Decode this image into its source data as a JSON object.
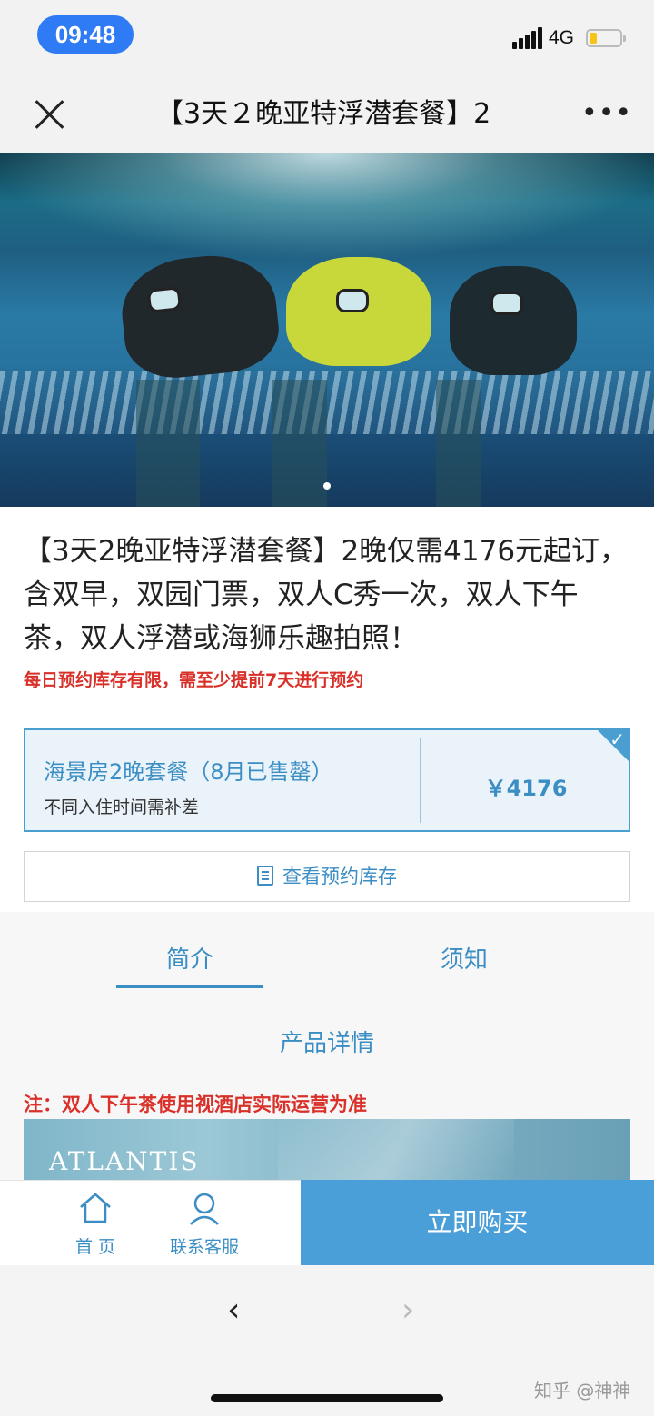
{
  "status_bar": {
    "time": "09:48",
    "network": "4G",
    "battery_level": 0.25
  },
  "nav": {
    "title": "【3天２晚亚特浮潜套餐】2",
    "close_icon": "close-icon",
    "more_label": "•••"
  },
  "product": {
    "title": "【3天2晚亚特浮潜套餐】2晚仅需4176元起订，含双早，双园门票，双人C秀一次，双人下午茶，双人浮潜或海狮乐趣拍照！",
    "notice": "每日预约库存有限，需至少提前7天进行预约"
  },
  "package": {
    "name": "海景房2晚套餐（8月已售罄）",
    "subtitle": "不同入住时间需补差",
    "price": "￥4176",
    "selected": true
  },
  "stock_button": {
    "label": "查看预约库存"
  },
  "tabs": [
    {
      "label": "简介",
      "active": true
    },
    {
      "label": "须知",
      "active": false
    }
  ],
  "details": {
    "heading": "产品详情",
    "note": "注：双人下午茶使用视酒店实际运营为准",
    "image_logo": "ATLANTIS"
  },
  "action_bar": {
    "home_label": "首 页",
    "service_label": "联系客服",
    "buy_label": "立即购买"
  },
  "browser": {
    "back": "‹",
    "forward": "›"
  },
  "watermark": "知乎 @神神",
  "colors": {
    "accent": "#3b8ec4",
    "buy_button": "#4a9fd8",
    "warning": "#d9302a",
    "time_pill": "#2f7bf6"
  }
}
